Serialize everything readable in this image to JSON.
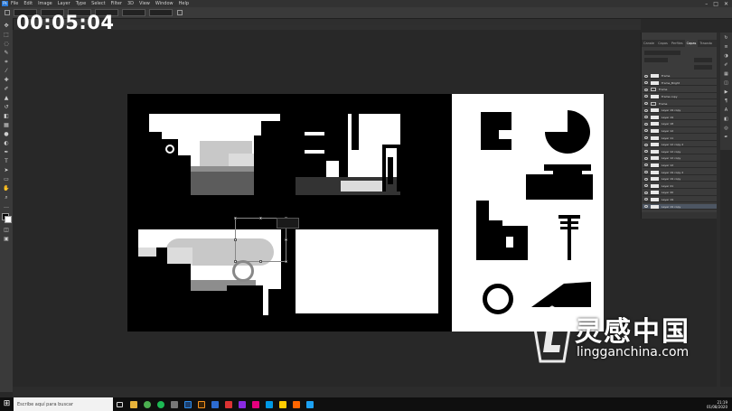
{
  "app": {
    "logo": "Ps",
    "menu": [
      "File",
      "Edit",
      "Image",
      "Layer",
      "Type",
      "Select",
      "Filter",
      "3D",
      "View",
      "Window",
      "Help"
    ],
    "window_controls": [
      "–",
      "□",
      "✕"
    ]
  },
  "timer": "00:05:04",
  "panels": {
    "tabs": [
      "Canale",
      "Capas",
      "Perfiles",
      "Capas",
      "Trazado"
    ],
    "active_tab_index": 3,
    "layers": [
      {
        "name": "Frame",
        "type": "layer"
      },
      {
        "name": "Frame_Bright",
        "type": "layer"
      },
      {
        "name": "Frame",
        "type": "folder"
      },
      {
        "name": "Frame copy",
        "type": "layer"
      },
      {
        "name": "Frame",
        "type": "folder"
      },
      {
        "name": "Layer 19 copy",
        "type": "layer"
      },
      {
        "name": "Layer 19",
        "type": "layer"
      },
      {
        "name": "Layer 18",
        "type": "layer"
      },
      {
        "name": "Layer 12",
        "type": "layer"
      },
      {
        "name": "Layer 11",
        "type": "layer"
      },
      {
        "name": "Layer 12 copy 2",
        "type": "layer"
      },
      {
        "name": "Layer 12 copy",
        "type": "layer"
      },
      {
        "name": "Layer 12 copy",
        "type": "layer"
      },
      {
        "name": "Layer 12",
        "type": "layer"
      },
      {
        "name": "Layer 19 copy 2",
        "type": "layer"
      },
      {
        "name": "Layer 19 copy",
        "type": "layer"
      },
      {
        "name": "Layer 21",
        "type": "layer"
      },
      {
        "name": "Layer 20",
        "type": "layer"
      },
      {
        "name": "Layer 19",
        "type": "layer"
      },
      {
        "name": "Layer 19 copy",
        "type": "layer",
        "selected": true
      }
    ]
  },
  "taskbar": {
    "start_icon": "⊞",
    "search_placeholder": "Escribe aquí para buscar",
    "time": "21:19",
    "date": "01/08/2020"
  },
  "watermark": {
    "cn": "灵感中国",
    "en": "lingganchina.com"
  }
}
